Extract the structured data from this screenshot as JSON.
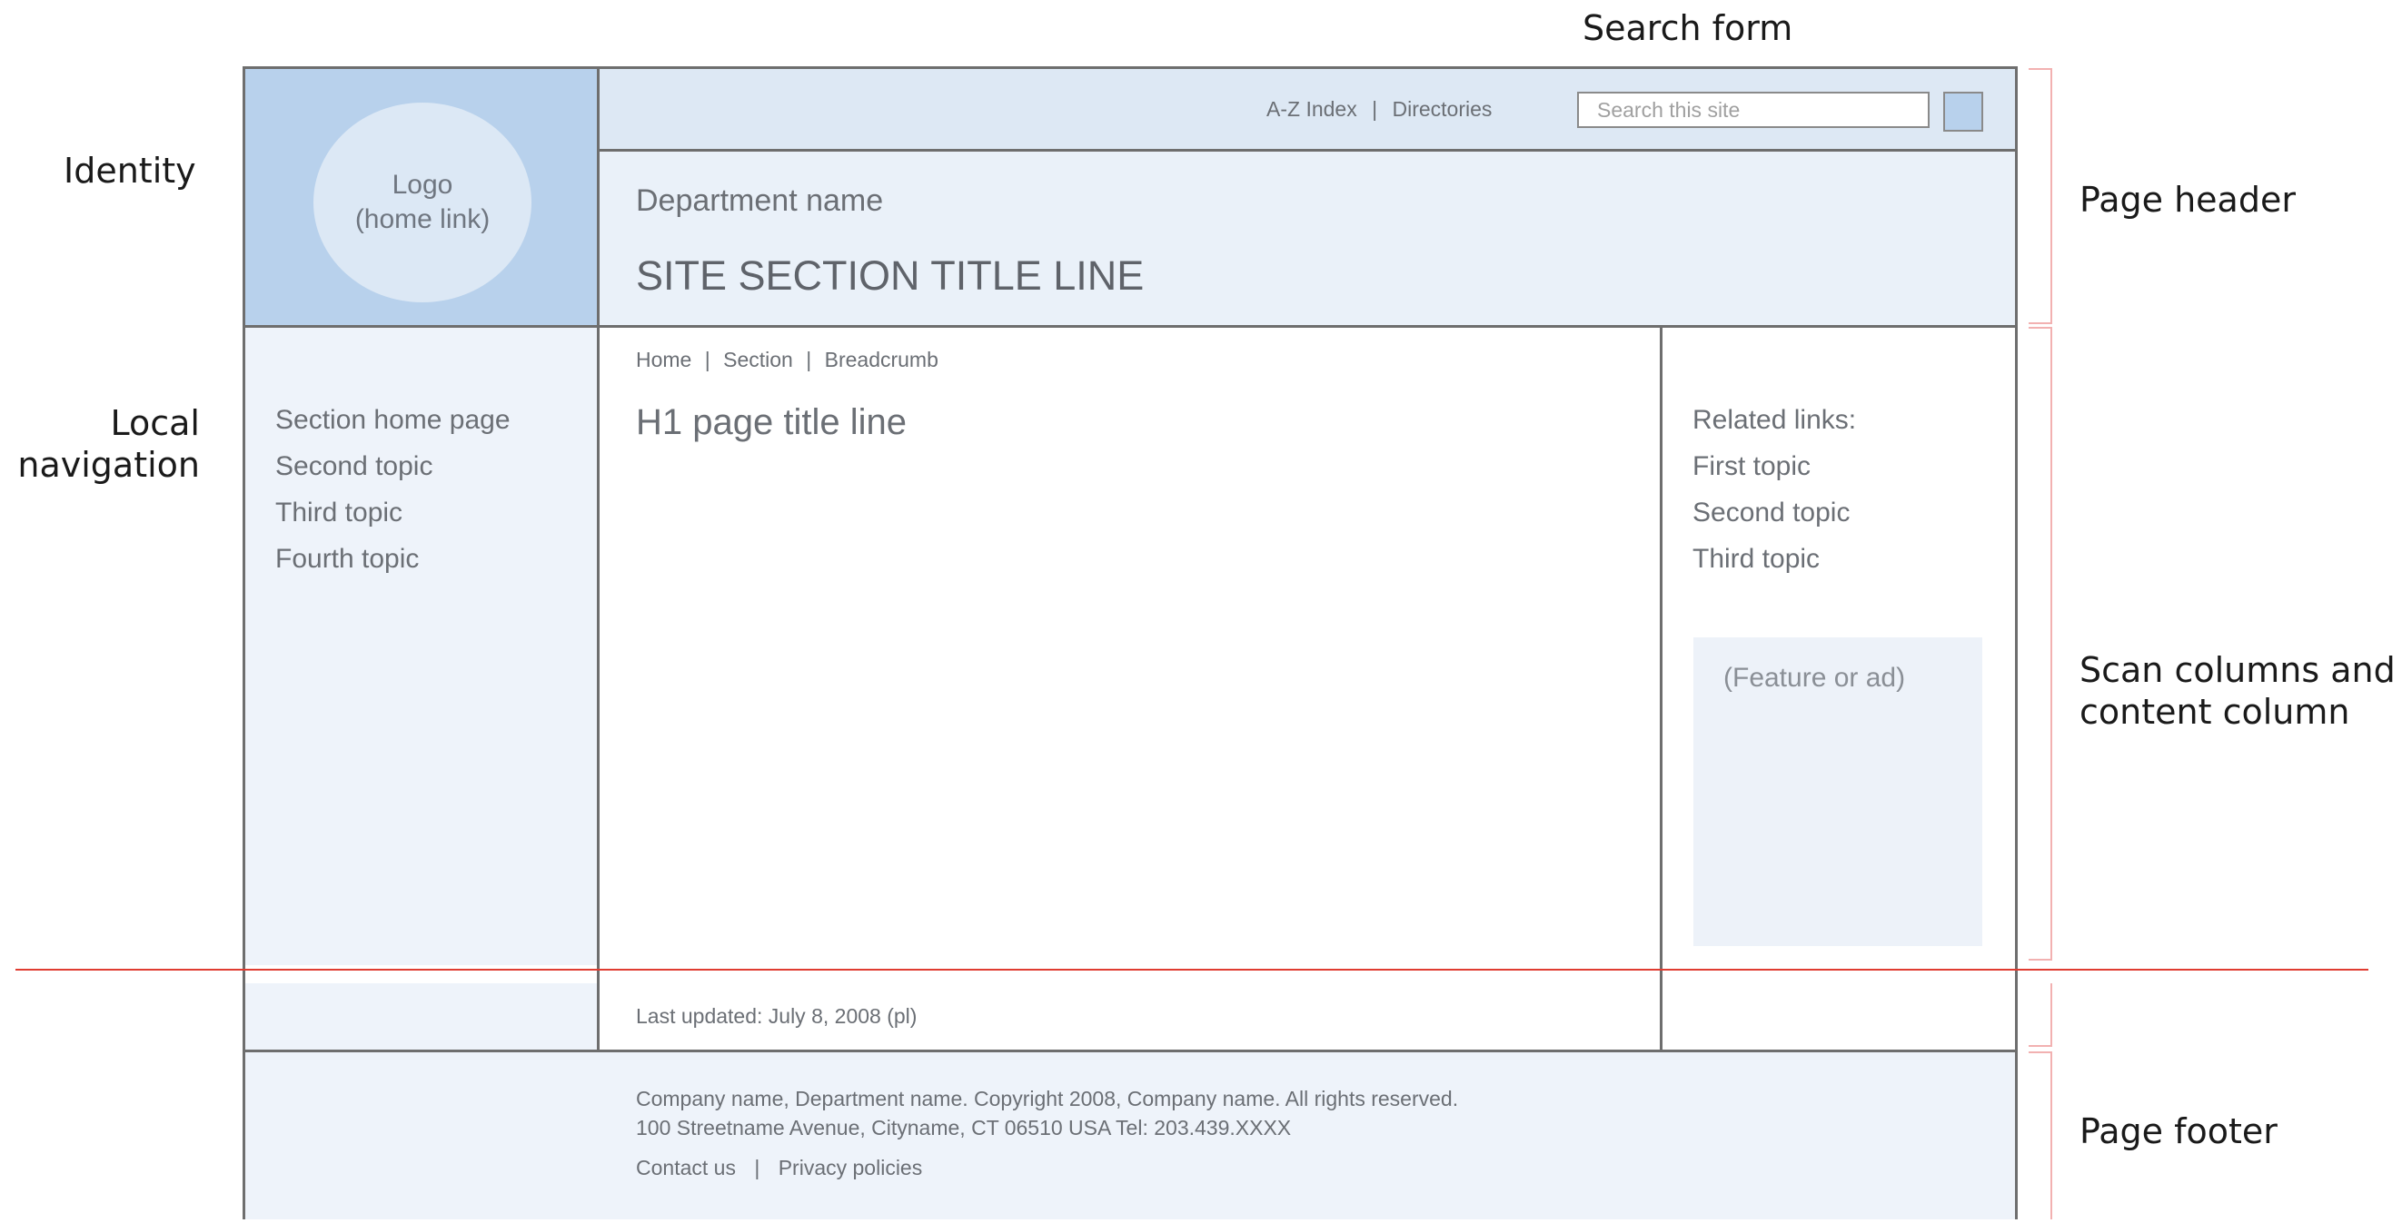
{
  "annotations": {
    "search_form": "Search form",
    "identity": "Identity",
    "local_navigation_line1": "Local",
    "local_navigation_line2": "navigation",
    "page_header": "Page header",
    "scan_columns_line1": "Scan columns and",
    "scan_columns_line2": "content column",
    "page_footer": "Page footer"
  },
  "header": {
    "logo_line1": "Logo",
    "logo_line2": "(home link)",
    "utility_links": {
      "az_index": "A-Z Index",
      "separator": "|",
      "directories": "Directories"
    },
    "search": {
      "placeholder": "Search this site"
    },
    "department_name": "Department name",
    "section_title": "SITE SECTION TITLE LINE"
  },
  "breadcrumb": {
    "home": "Home",
    "section": "Section",
    "current": "Breadcrumb",
    "separator": "|"
  },
  "content": {
    "h1": "H1 page title line"
  },
  "local_nav": {
    "items": [
      "Section home page",
      "Second topic",
      "Third topic",
      "Fourth topic"
    ]
  },
  "related": {
    "heading": "Related links:",
    "items": [
      "First topic",
      "Second topic",
      "Third topic"
    ],
    "feature": "(Feature or ad)"
  },
  "last_updated": "Last updated: July 8, 2008 (pl)",
  "footer": {
    "line1": "Company name, Department name. Copyright 2008, Company name. All rights reserved.",
    "line2": "100 Streetname Avenue, Cityname, CT 06510  USA    Tel: 203.439.XXXX",
    "contact": "Contact us",
    "separator": "|",
    "privacy": "Privacy policies"
  },
  "colors": {
    "identity_bg": "#b8d1ec",
    "panel_bg": "#eef3fa",
    "divider_red": "#e03c31",
    "bracket_pink": "#f2b1b1"
  }
}
